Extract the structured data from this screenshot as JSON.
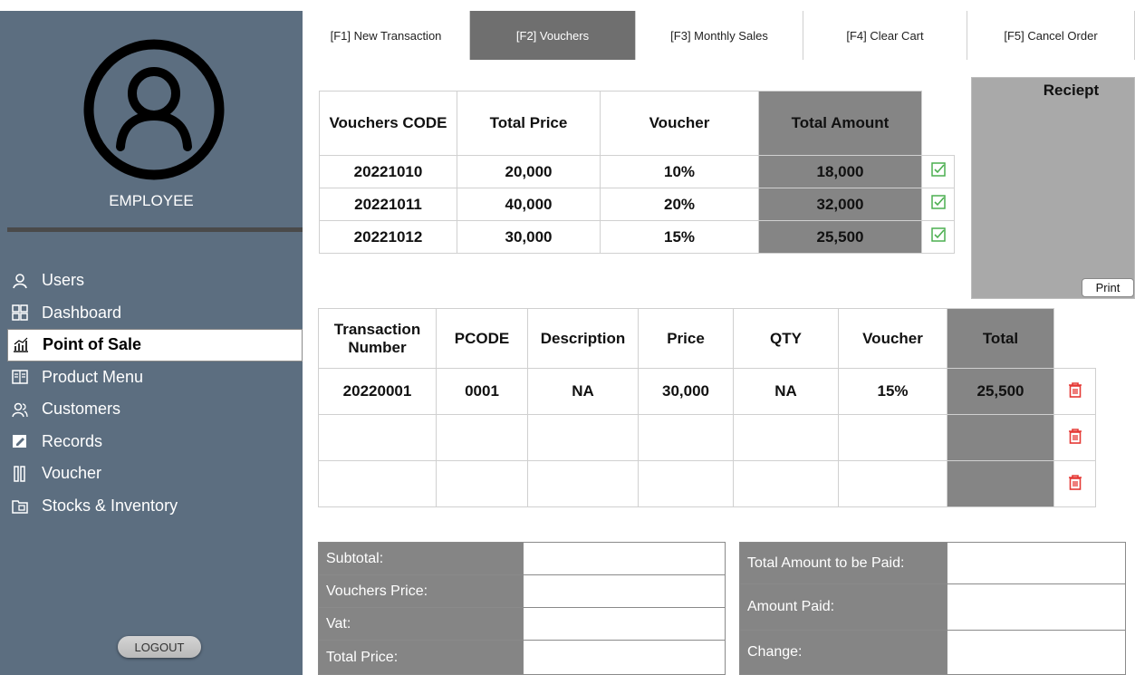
{
  "sidebar": {
    "role_label": "EMPLOYEE",
    "nav": [
      {
        "label": "Users",
        "icon": "user-icon"
      },
      {
        "label": "Dashboard",
        "icon": "dashboard-icon"
      },
      {
        "label": "Point of Sale",
        "icon": "chart-icon"
      },
      {
        "label": "Product Menu",
        "icon": "book-icon"
      },
      {
        "label": "Customers",
        "icon": "users-icon"
      },
      {
        "label": "Records",
        "icon": "edit-icon"
      },
      {
        "label": "Voucher",
        "icon": "voucher-icon"
      },
      {
        "label": "Stocks & Inventory",
        "icon": "inventory-icon"
      }
    ],
    "logout_label": "LOGOUT"
  },
  "tabs": [
    {
      "label": "[F1] New Transaction"
    },
    {
      "label": "[F2] Vouchers"
    },
    {
      "label": "[F3] Monthly Sales"
    },
    {
      "label": "[F4] Clear Cart"
    },
    {
      "label": "[F5] Cancel Order"
    }
  ],
  "vouchers": {
    "headers": [
      "Vouchers CODE",
      "Total Price",
      "Voucher",
      "Total Amount"
    ],
    "rows": [
      {
        "code": "20221010",
        "total_price": "20,000",
        "voucher": "10%",
        "total_amount": "18,000"
      },
      {
        "code": "20221011",
        "total_price": "40,000",
        "voucher": "20%",
        "total_amount": "32,000"
      },
      {
        "code": "20221012",
        "total_price": "30,000",
        "voucher": "15%",
        "total_amount": "25,500"
      }
    ]
  },
  "receipt": {
    "title": "Reciept",
    "print_label": "Print"
  },
  "transactions": {
    "headers": [
      "Transaction Number",
      "PCODE",
      "Description",
      "Price",
      "QTY",
      "Voucher",
      "Total"
    ],
    "rows": [
      {
        "number": "20220001",
        "pcode": "0001",
        "description": "NA",
        "price": "30,000",
        "qty": "NA",
        "voucher": "15%",
        "total": "25,500"
      },
      {
        "number": "",
        "pcode": "",
        "description": "",
        "price": "",
        "qty": "",
        "voucher": "",
        "total": ""
      },
      {
        "number": "",
        "pcode": "",
        "description": "",
        "price": "",
        "qty": "",
        "voucher": "",
        "total": ""
      }
    ]
  },
  "summary_left": [
    "Subtotal:",
    "Vouchers Price:",
    "Vat:",
    "Total Price:"
  ],
  "summary_right": [
    "Total Amount to be Paid:",
    "Amount Paid:",
    "Change:"
  ],
  "colors": {
    "sidebar": "#5c6e80",
    "tab_active": "#6f6f6f",
    "grey_cell": "#858585",
    "check_green": "#4caf50",
    "trash_red": "#e53935"
  }
}
